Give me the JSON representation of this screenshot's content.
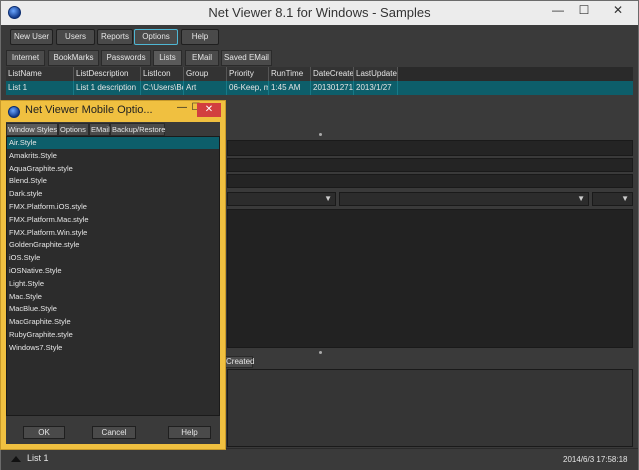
{
  "window": {
    "title": "Net Viewer 8.1 for Windows - Samples",
    "minimize": "—",
    "maximize": "☐",
    "close": "✕"
  },
  "toolbar": {
    "buttons": [
      "New User",
      "Users",
      "Reports",
      "Options",
      "Help"
    ]
  },
  "tabs": [
    "Internet",
    "BookMarks",
    "Passwords",
    "Lists",
    "EMail",
    "Saved EMail"
  ],
  "grid": {
    "headers": [
      "ListName",
      "ListDescription",
      "ListIcon",
      "Group",
      "Priority",
      "RunTime",
      "DateCreated",
      "LastUpdated"
    ],
    "row": [
      "List 1",
      "List 1 description",
      "C:\\Users\\Bc",
      "Art",
      "06-Keep, m",
      "1:45 AM",
      "201301271",
      "2013/1/27"
    ]
  },
  "lower_panel": {
    "created_label": "Created"
  },
  "status": {
    "left": "List 1",
    "right": "2014/6/3 17:58:18"
  },
  "dialog": {
    "title": "Net Viewer Mobile Optio...",
    "minimize": "—",
    "maximize": "☐",
    "close": "✕",
    "tabs": [
      "Window Styles",
      "Options",
      "EMail",
      "Backup/Restore"
    ],
    "styles": [
      "Air.Style",
      "Amakrits.Style",
      "AquaGraphite.style",
      "Blend.Style",
      "Dark.style",
      "FMX.Platform.iOS.style",
      "FMX.Platform.Mac.style",
      "FMX.Platform.Win.style",
      "GoldenGraphite.style",
      "iOS.Style",
      "iOSNative.Style",
      "Light.Style",
      "Mac.Style",
      "MacBlue.Style",
      "MacGraphite.Style",
      "RubyGraphite.style",
      "Windows7.Style"
    ],
    "ok": "OK",
    "cancel": "Cancel",
    "help": "Help"
  },
  "colors": {
    "accent": "#0d5e6a",
    "dialog_frame": "#f0c040",
    "active_border": "#4fb7d4"
  }
}
